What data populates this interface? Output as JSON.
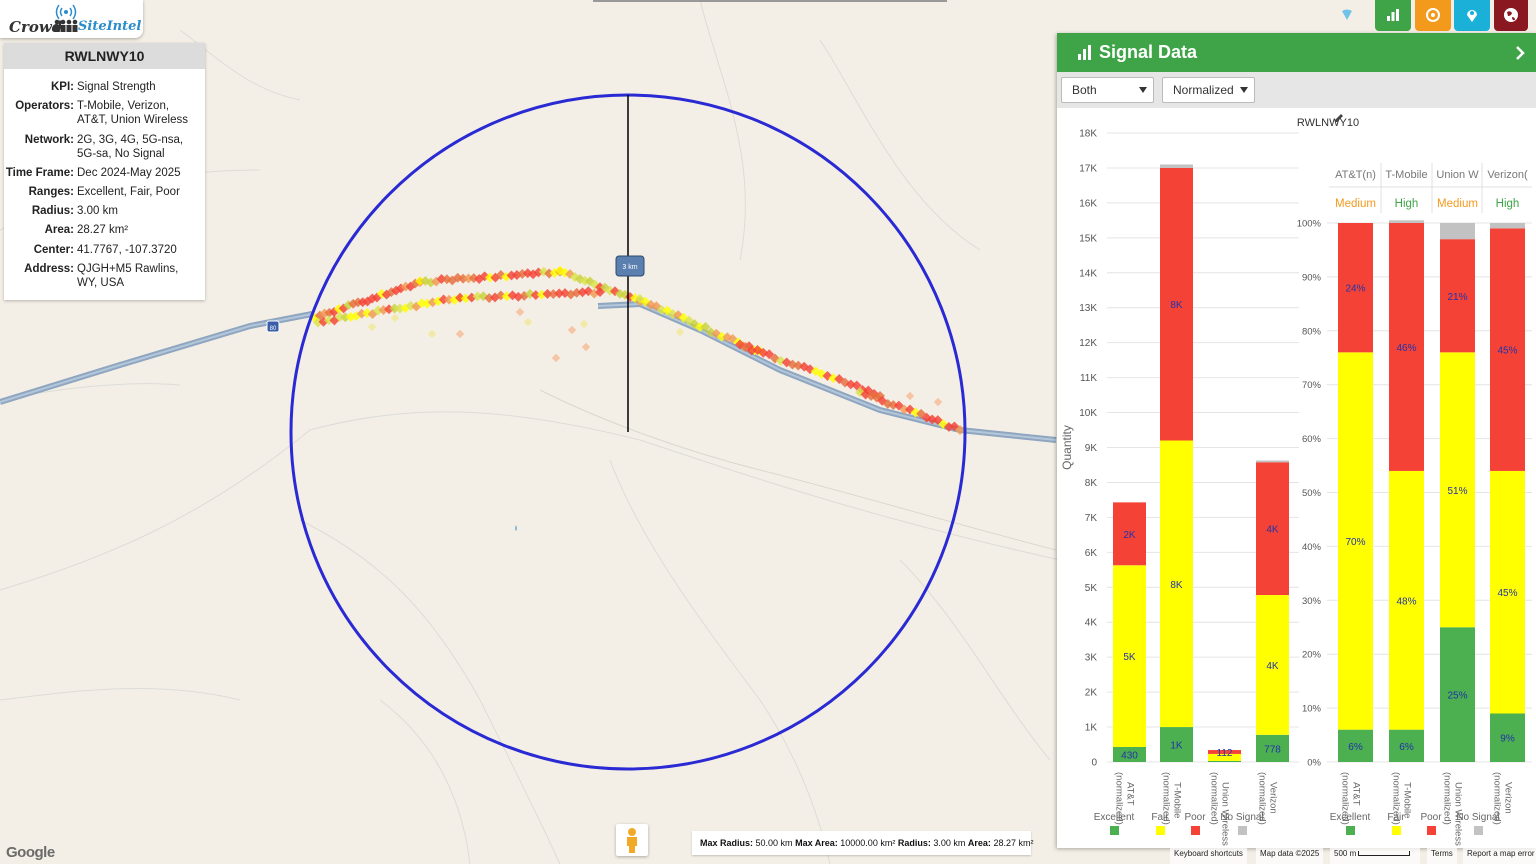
{
  "brand": {
    "word1": "Crowd",
    "word2": "SiteIntel"
  },
  "site": {
    "name": "RWLNWY10",
    "fields": [
      {
        "key": "KPI:",
        "value": "Signal Strength"
      },
      {
        "key": "Operators:",
        "value": "T-Mobile, Verizon, AT&T, Union Wireless"
      },
      {
        "key": "Network:",
        "value": "2G, 3G, 4G, 5G-nsa, 5G-sa, No Signal"
      },
      {
        "key": "Time Frame:",
        "value": "Dec 2024-May 2025"
      },
      {
        "key": "Ranges:",
        "value": "Excellent, Fair, Poor"
      },
      {
        "key": "Radius:",
        "value": "3.00 km"
      },
      {
        "key": "Area:",
        "value": "28.27 km²"
      },
      {
        "key": "Center:",
        "value": "41.7767, -107.3720"
      },
      {
        "key": "Address:",
        "value": "QJGH+M5 Rawlins, WY, USA"
      }
    ]
  },
  "map": {
    "radius_label": "3 km",
    "highway_shield": "80",
    "stats": {
      "max_radius_label": "Max Radius:",
      "max_radius": "50.00 km",
      "max_area_label": "Max Area:",
      "max_area": "10000.00 km²",
      "radius_label": "Radius:",
      "radius": "3.00 km",
      "area_label": "Area:",
      "area": "28.27 km²"
    },
    "footer": {
      "google": "Google",
      "shortcuts": "Keyboard shortcuts",
      "mapdata": "Map data ©2025",
      "scale": "500 m",
      "terms": "Terms",
      "report": "Report a map error"
    }
  },
  "toolbar": [
    {
      "name": "chart-button",
      "icon": "bar-chart-icon",
      "color": "#3ea447"
    },
    {
      "name": "target-button",
      "icon": "target-icon",
      "color": "#f39a1d"
    },
    {
      "name": "location-button",
      "icon": "map-pin-icon",
      "color": "#1ab0d8"
    },
    {
      "name": "globe-button",
      "icon": "globe-icon",
      "color": "#8a1820"
    }
  ],
  "panel": {
    "title": "Signal Data",
    "select_mode": "Both",
    "select_scale": "Normalized"
  },
  "colors": {
    "excellent": "#4caf50",
    "fair": "#ffff00",
    "poor": "#f44336",
    "no_signal": "#c2c2c2",
    "circle": "#2a2ad4"
  },
  "chart_data": [
    {
      "type": "bar",
      "title": "RWLNWY10",
      "ylabel": "Quantity",
      "ylim": [
        0,
        18000
      ],
      "yticks": [
        "0",
        "1K",
        "2K",
        "3K",
        "4K",
        "5K",
        "6K",
        "7K",
        "8K",
        "9K",
        "10K",
        "11K",
        "12K",
        "13K",
        "14K",
        "15K",
        "16K",
        "17K",
        "18K"
      ],
      "categories": [
        "AT&T (normalized)",
        "T-Mobile (normalized)",
        "Union Wireless (normalized)",
        "Verizon (normalized)"
      ],
      "series": [
        {
          "name": "Excellent",
          "values": [
            430,
            1000,
            30,
            778
          ],
          "labels": [
            "430",
            "1K",
            "",
            "778"
          ]
        },
        {
          "name": "Fair",
          "values": [
            5200,
            8200,
            200,
            4000
          ],
          "labels": [
            "5K",
            "8K",
            "",
            "4K"
          ]
        },
        {
          "name": "Poor",
          "values": [
            1800,
            7800,
            112,
            3800
          ],
          "labels": [
            "2K",
            "8K",
            "112",
            "4K"
          ]
        },
        {
          "name": "No Signal",
          "values": [
            0,
            100,
            0,
            50
          ],
          "labels": [
            "",
            "",
            "",
            ""
          ]
        }
      ]
    },
    {
      "type": "bar",
      "ylim": [
        0,
        100
      ],
      "yticks": [
        "0%",
        "10%",
        "20%",
        "30%",
        "40%",
        "50%",
        "60%",
        "70%",
        "80%",
        "90%",
        "100%"
      ],
      "categories": [
        "AT&T (normalized)",
        "T-Mobile (normalized)",
        "Union Wireless (normalized)",
        "Verizon (normalized)"
      ],
      "header_names": [
        "AT&T(n)",
        "T-Mobile",
        "Union W",
        "Verizon("
      ],
      "header_levels": [
        "Medium",
        "High",
        "Medium",
        "High"
      ],
      "series": [
        {
          "name": "Excellent",
          "values": [
            6,
            6,
            25,
            9
          ],
          "labels": [
            "6%",
            "6%",
            "25%",
            "9%"
          ]
        },
        {
          "name": "Fair",
          "values": [
            70,
            48,
            51,
            45
          ],
          "labels": [
            "70%",
            "48%",
            "51%",
            "45%"
          ]
        },
        {
          "name": "Poor",
          "values": [
            24,
            46,
            21,
            45
          ],
          "labels": [
            "24%",
            "46%",
            "21%",
            "45%"
          ]
        },
        {
          "name": "No Signal",
          "values": [
            0,
            0.5,
            3,
            1
          ],
          "labels": [
            "",
            "",
            "",
            ""
          ]
        }
      ]
    }
  ]
}
